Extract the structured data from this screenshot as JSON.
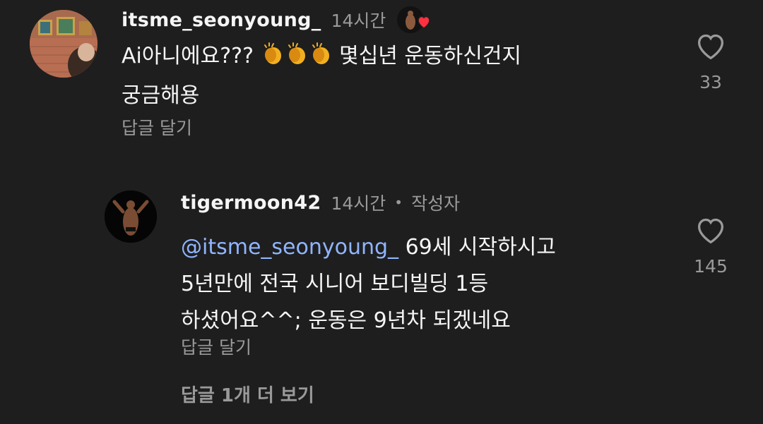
{
  "comment": {
    "username": "itsme_seonyoung_",
    "time": "14시간",
    "text_prefix": "Ai아니에요??? ",
    "text_suffix": " 몇십년 운동하신건지\n궁금해용",
    "emoji": "clapping-hands",
    "reply_label": "답글 달기",
    "like_count": "33",
    "icons": [
      "heart-outline-icon",
      "liked-by-author-heart-icon"
    ]
  },
  "reply": {
    "username": "tigermoon42",
    "time": "14시간",
    "separator": "•",
    "author_tag": "작성자",
    "mention": "@itsme_seonyoung_",
    "text": " 69세 시작하시고\n5년만에 전국 시니어 보디빌딩 1등\n하셨어요^^; 운동은 9년차 되겠네요",
    "reply_label": "답글 달기",
    "like_count": "145"
  },
  "more_replies_label": "답글 1개 더 보기",
  "colors": {
    "background": "#1e1e1e",
    "text": "#f5f5f5",
    "secondary": "#9a9a9a",
    "mention": "#8fb5ff",
    "heart": "#ff3040"
  }
}
